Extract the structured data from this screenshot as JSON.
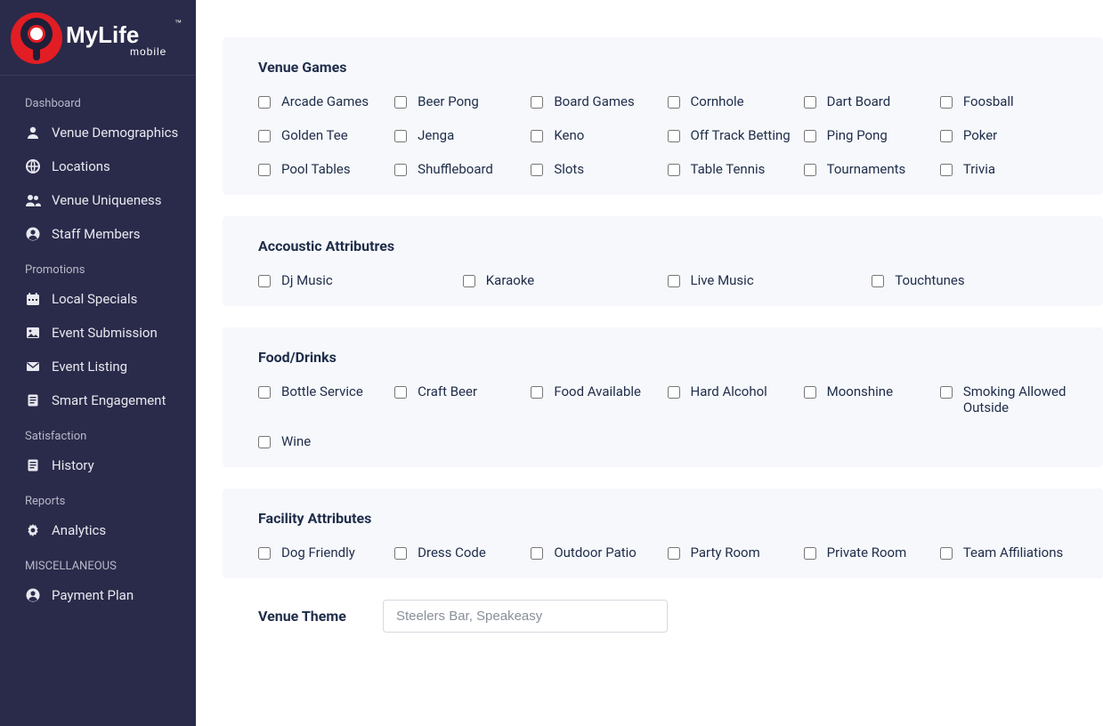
{
  "brand": {
    "name": "MyLife",
    "sub": "mobile"
  },
  "sidebar": {
    "groups": [
      {
        "heading": "Dashboard",
        "items": [
          {
            "icon": "user-icon",
            "label": "Venue Demographics"
          },
          {
            "icon": "globe-icon",
            "label": "Locations"
          },
          {
            "icon": "users-icon",
            "label": "Venue Uniqueness"
          },
          {
            "icon": "account-icon",
            "label": "Staff Members"
          }
        ]
      },
      {
        "heading": "Promotions",
        "items": [
          {
            "icon": "calendar-icon",
            "label": "Local Specials"
          },
          {
            "icon": "image-icon",
            "label": "Event Submission"
          },
          {
            "icon": "mail-icon",
            "label": "Event Listing"
          },
          {
            "icon": "doc-icon",
            "label": "Smart Engagement"
          }
        ]
      },
      {
        "heading": "Satisfaction",
        "items": [
          {
            "icon": "doc-icon",
            "label": "History"
          }
        ]
      },
      {
        "heading": "Reports",
        "items": [
          {
            "icon": "gear-icon",
            "label": "Analytics"
          }
        ]
      },
      {
        "heading": "MISCELLANEOUS",
        "items": [
          {
            "icon": "account-icon",
            "label": "Payment Plan"
          }
        ]
      }
    ]
  },
  "sections": [
    {
      "title": "Venue Games",
      "cols": 6,
      "items": [
        "Arcade Games",
        "Beer Pong",
        "Board Games",
        "Cornhole",
        "Dart Board",
        "Foosball",
        "Golden Tee",
        "Jenga",
        "Keno",
        "Off Track Betting",
        "Ping Pong",
        "Poker",
        "Pool Tables",
        "Shuffleboard",
        "Slots",
        "Table Tennis",
        "Tournaments",
        "Trivia"
      ]
    },
    {
      "title": "Accoustic Attributres",
      "cols": 4,
      "items": [
        "Dj Music",
        "Karaoke",
        "Live Music",
        "Touchtunes"
      ]
    },
    {
      "title": "Food/Drinks",
      "cols": 6,
      "items": [
        "Bottle Service",
        "Craft Beer",
        "Food Available",
        "Hard Alcohol",
        "Moonshine",
        "Smoking Allowed Outside",
        "Wine"
      ]
    },
    {
      "title": "Facility Attributes",
      "cols": 6,
      "items": [
        "Dog Friendly",
        "Dress Code",
        "Outdoor Patio",
        "Party Room",
        "Private Room",
        "Team Affiliations"
      ]
    }
  ],
  "venue_theme": {
    "label": "Venue Theme",
    "placeholder": "Steelers Bar, Speakeasy",
    "value": ""
  }
}
